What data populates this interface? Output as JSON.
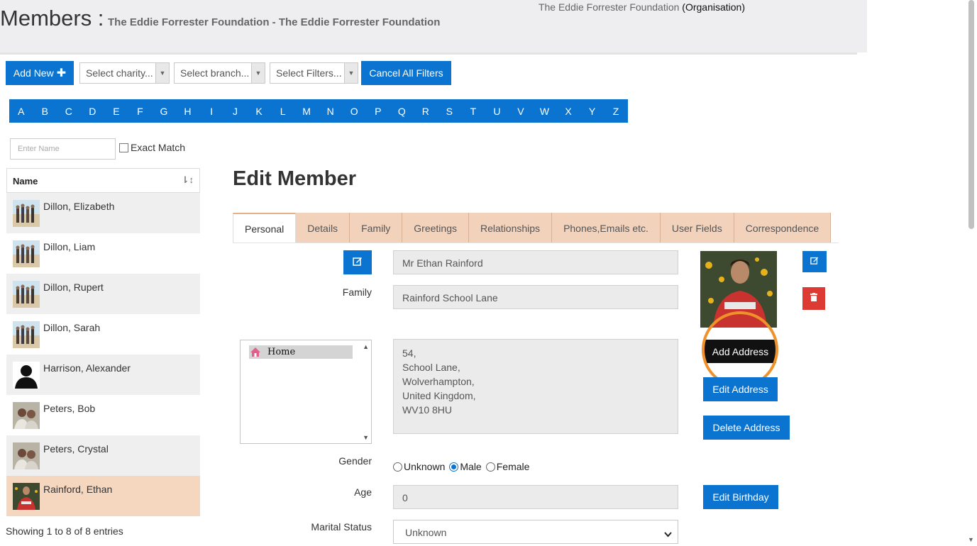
{
  "header": {
    "title": "Members :",
    "subtitle": "The Eddie Forrester Foundation - The Eddie Forrester Foundation",
    "org_name": "The Eddie Forrester Foundation",
    "org_tag": "(Organisation)"
  },
  "toolbar": {
    "add_new_label": "Add New",
    "charity_placeholder": "Select charity...",
    "branch_placeholder": "Select branch...",
    "filters_placeholder": "Select Filters...",
    "cancel_filters_label": "Cancel All Filters"
  },
  "alphabet": [
    "A",
    "B",
    "C",
    "D",
    "E",
    "F",
    "G",
    "H",
    "I",
    "J",
    "K",
    "L",
    "M",
    "N",
    "O",
    "P",
    "Q",
    "R",
    "S",
    "T",
    "U",
    "V",
    "W",
    "X",
    "Y",
    "Z"
  ],
  "search": {
    "name_placeholder": "Enter Name",
    "exact_match_label": "Exact Match"
  },
  "member_list": {
    "column_header": "Name",
    "members": [
      {
        "name": "Dillon, Elizabeth",
        "photo": "beach-group"
      },
      {
        "name": "Dillon, Liam",
        "photo": "beach-group"
      },
      {
        "name": "Dillon, Rupert",
        "photo": "beach-group"
      },
      {
        "name": "Dillon, Sarah",
        "photo": "beach-group"
      },
      {
        "name": "Harrison, Alexander",
        "photo": "silhouette"
      },
      {
        "name": "Peters, Bob",
        "photo": "couple"
      },
      {
        "name": "Peters, Crystal",
        "photo": "couple"
      },
      {
        "name": "Rainford, Ethan",
        "photo": "man-red-hoodie",
        "selected": true
      }
    ],
    "footer": "Showing 1 to 8 of 8 entries"
  },
  "edit_member": {
    "title": "Edit Member",
    "tabs": [
      "Personal",
      "Details",
      "Family",
      "Greetings",
      "Relationships",
      "Phones,Emails etc.",
      "User Fields",
      "Correspondence"
    ],
    "active_tab": "Personal",
    "full_name": "Mr Ethan Rainford",
    "family_label": "Family",
    "family_value": "Rainford School Lane",
    "address_types": [
      "Home"
    ],
    "address_lines": [
      "54,",
      "School Lane,",
      "Wolverhampton,",
      "United Kingdom,",
      "WV10 8HU"
    ],
    "add_address_label": "Add Address",
    "edit_address_label": "Edit Address",
    "delete_address_label": "Delete Address",
    "gender_label": "Gender",
    "gender_options": [
      "Unknown",
      "Male",
      "Female"
    ],
    "gender_selected": "Male",
    "age_label": "Age",
    "age_value": "0",
    "edit_birthday_label": "Edit Birthday",
    "marital_label": "Marital Status",
    "marital_value": "Unknown"
  },
  "colors": {
    "primary": "#0b74d1",
    "danger": "#dd3a33",
    "tab_bg": "#f3d2bc",
    "selected_row": "#f5d6bf",
    "highlight_ring": "#f0922b"
  }
}
